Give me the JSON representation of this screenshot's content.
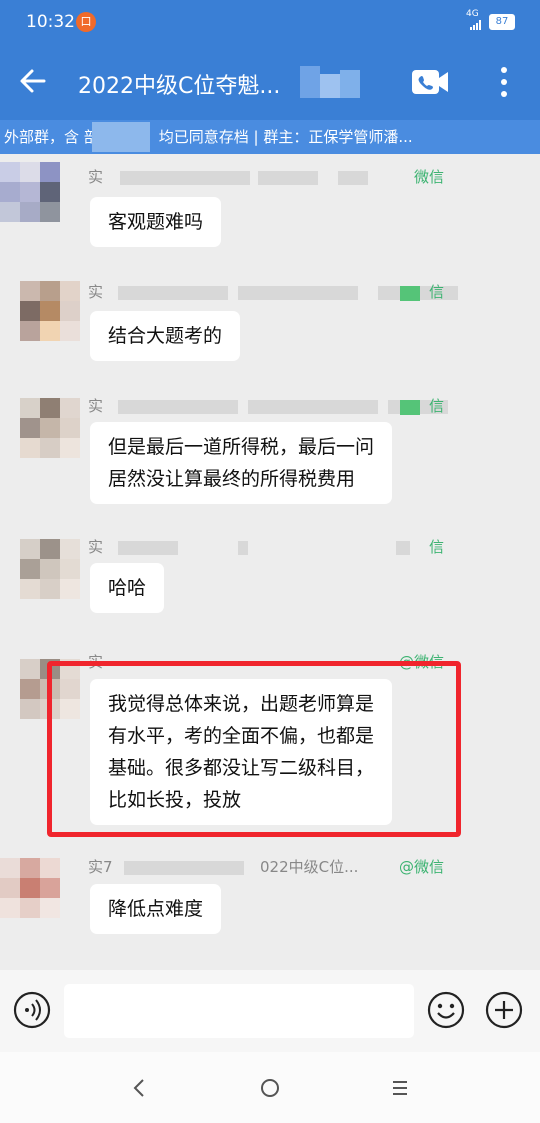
{
  "status_bar": {
    "time": "10:32",
    "notification_badge": "口",
    "network": "4G",
    "battery": "87"
  },
  "header": {
    "title": "2022中级C位夺魁..."
  },
  "notice": {
    "text": "外部群，含            部联系人，均已同意存档 | 群主：正保学管师潘..."
  },
  "messages": [
    {
      "sender": "实",
      "source": "微信",
      "text": "客观题难吗"
    },
    {
      "sender": "实",
      "source": "信",
      "text": "结合大题考的"
    },
    {
      "sender": "实",
      "source": "信",
      "text": "但是最后一道所得税，最后一问\n居然没让算最终的所得税费用"
    },
    {
      "sender": "实",
      "source": "信",
      "text": "哈哈"
    },
    {
      "sender": "实",
      "source": "@微信",
      "text": "我觉得总体来说，出题老师算是\n有水平，考的全面不偏，也都是\n基础。很多都没让写二级科目，\n比如长投，投放"
    },
    {
      "sender": "实7",
      "group": "022中级C位...",
      "source": "@微信",
      "text": "降低点难度"
    }
  ],
  "input": {
    "placeholder": ""
  },
  "icons": {
    "back": "arrow-left-icon",
    "video": "video-call-icon",
    "more": "more-vertical-icon",
    "voice": "voice-input-icon",
    "emoji": "emoji-icon",
    "plus": "plus-icon",
    "nav_back": "nav-back-icon",
    "nav_home": "nav-home-icon",
    "nav_menu": "nav-menu-icon"
  },
  "colors": {
    "brand_blue": "#3a7fd5",
    "wechat_green": "#3cb371",
    "highlight_red": "#f0252d"
  }
}
